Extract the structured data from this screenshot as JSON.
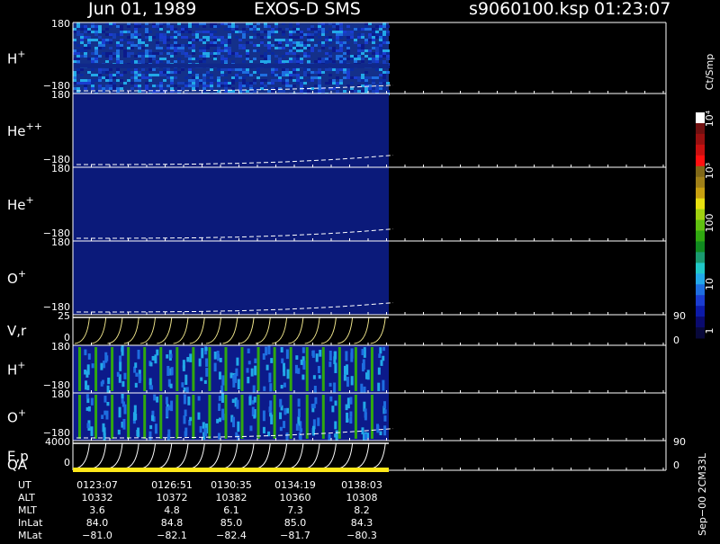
{
  "header": {
    "date": "Jun 01, 1989",
    "instrument": "EXOS-D SMS",
    "file": "s9060100.ksp",
    "time": "01:23:07"
  },
  "panels": [
    {
      "label": "H",
      "sup": "+",
      "top": "180",
      "bottom": "−180"
    },
    {
      "label": "He",
      "sup": "++",
      "top": "180",
      "bottom": "−180"
    },
    {
      "label": "He",
      "sup": "+",
      "top": "180",
      "bottom": "−180"
    },
    {
      "label": "O",
      "sup": "+",
      "top": "180",
      "bottom": "−180"
    },
    {
      "label": "V,r",
      "sup": "",
      "top": "25",
      "bottom": "0",
      "right_top": "90",
      "right_bottom": "0"
    },
    {
      "label": "H",
      "sup": "+",
      "top": "180",
      "bottom": "−180"
    },
    {
      "label": "O",
      "sup": "+",
      "top": "180",
      "bottom": "−180"
    },
    {
      "label": "E,p",
      "sup": "",
      "top": "4000",
      "bottom": "0",
      "right_top": "90",
      "right_bottom": "0"
    }
  ],
  "qa_label": "QA",
  "colorbar": {
    "unit": "Ct/Smp",
    "ticks": [
      "1",
      "10",
      "100",
      "10³",
      "10⁴"
    ],
    "colors": [
      "#08083a",
      "#0a0a6e",
      "#0c1aa8",
      "#1a3cd0",
      "#1e6ee0",
      "#22a8e8",
      "#20c8c8",
      "#1a9a70",
      "#108a20",
      "#30a810",
      "#60c010",
      "#a0d010",
      "#e8e010",
      "#c8a010",
      "#a08018",
      "#806818",
      "#ff1010",
      "#c81010",
      "#981010",
      "#701010",
      "#ffffff"
    ]
  },
  "footer_note": "Sep−00 2CM33L",
  "ephemeris": {
    "row_labels": [
      "UT",
      "ALT",
      "MLT",
      "InLat",
      "MLat"
    ],
    "columns": [
      [
        "0123:07",
        "10332",
        "3.6",
        "84.0",
        "−81.0"
      ],
      [
        "0126:51",
        "10372",
        "4.8",
        "84.8",
        "−82.1"
      ],
      [
        "0130:35",
        "10382",
        "6.1",
        "85.0",
        "−82.4"
      ],
      [
        "0134:19",
        "10360",
        "7.3",
        "85.0",
        "−81.7"
      ],
      [
        "0138:03",
        "10308",
        "8.2",
        "84.3",
        "−80.3"
      ]
    ]
  },
  "chart_data": {
    "type": "heatmap",
    "title": "Jun 01, 1989   EXOS-D SMS",
    "colorscale": "log",
    "colorbar_range": [
      1,
      10000
    ],
    "x_time_ticks": [
      "0123:07",
      "0126:51",
      "0130:35",
      "0134:19",
      "0138:03"
    ],
    "panels": [
      {
        "name": "H+",
        "ylim": [
          -180,
          180
        ],
        "background_level": "mid"
      },
      {
        "name": "He++",
        "ylim": [
          -180,
          180
        ],
        "background_level": "low"
      },
      {
        "name": "He+",
        "ylim": [
          -180,
          180
        ],
        "background_level": "low"
      },
      {
        "name": "O+",
        "ylim": [
          -180,
          180
        ],
        "background_level": "low"
      },
      {
        "name": "V,r",
        "ylim": [
          0,
          25
        ],
        "right_ylim": [
          0,
          90
        ]
      },
      {
        "name": "H+",
        "ylim": [
          -180,
          180
        ],
        "background_level": "spiky"
      },
      {
        "name": "O+",
        "ylim": [
          -180,
          180
        ],
        "background_level": "spiky"
      },
      {
        "name": "E,p",
        "ylim": [
          0,
          4000
        ],
        "right_ylim": [
          0,
          90
        ]
      }
    ],
    "sweep_count": 19,
    "qa": "good"
  }
}
